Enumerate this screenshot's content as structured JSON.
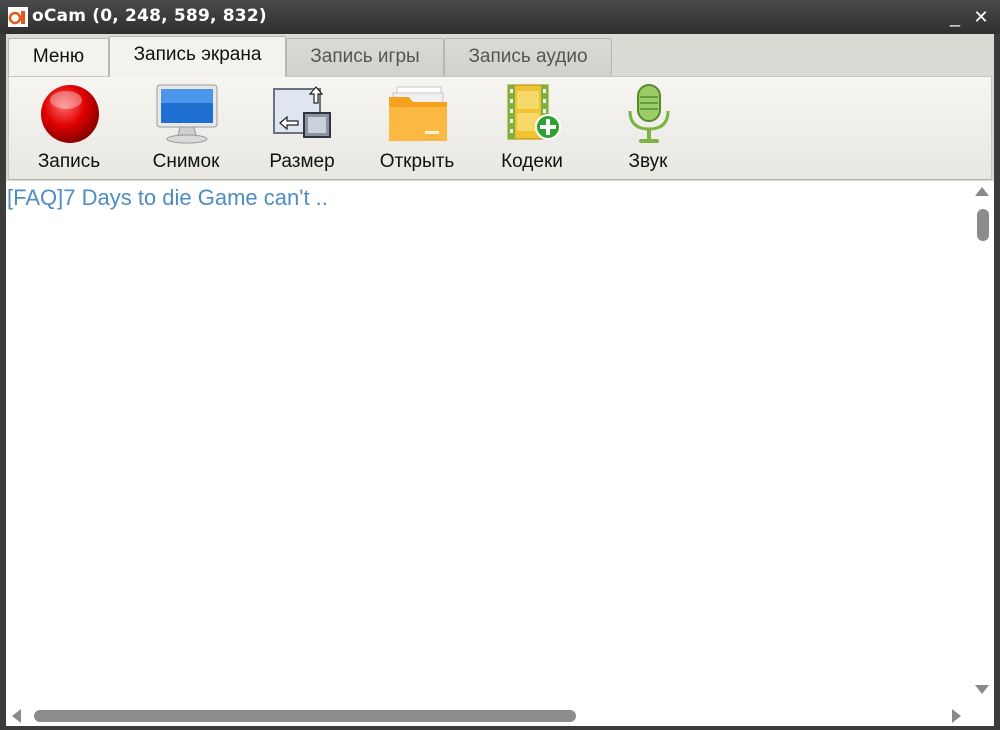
{
  "window": {
    "title": "oCam (0, 248, 589, 832)",
    "minimize_glyph": "_",
    "close_glyph": "✕"
  },
  "tabs": [
    {
      "label": "Меню",
      "active": false
    },
    {
      "label": "Запись экрана",
      "active": true
    },
    {
      "label": "Запись игры",
      "active": false
    },
    {
      "label": "Запись аудио",
      "active": false
    }
  ],
  "toolbar": {
    "items": [
      {
        "label": "Запись",
        "icon": "record-icon"
      },
      {
        "label": "Снимок",
        "icon": "monitor-icon"
      },
      {
        "label": "Размер",
        "icon": "resize-icon"
      },
      {
        "label": "Открыть",
        "icon": "folder-icon"
      },
      {
        "label": "Кодеки",
        "icon": "film-add-icon"
      },
      {
        "label": "Звук",
        "icon": "microphone-icon"
      }
    ]
  },
  "content": {
    "link_text": "[FAQ]7 Days to die Game can't .."
  },
  "colors": {
    "link": "#4f8cc2",
    "record_red": "#d40000",
    "titlebar": "#3a3a3a"
  }
}
